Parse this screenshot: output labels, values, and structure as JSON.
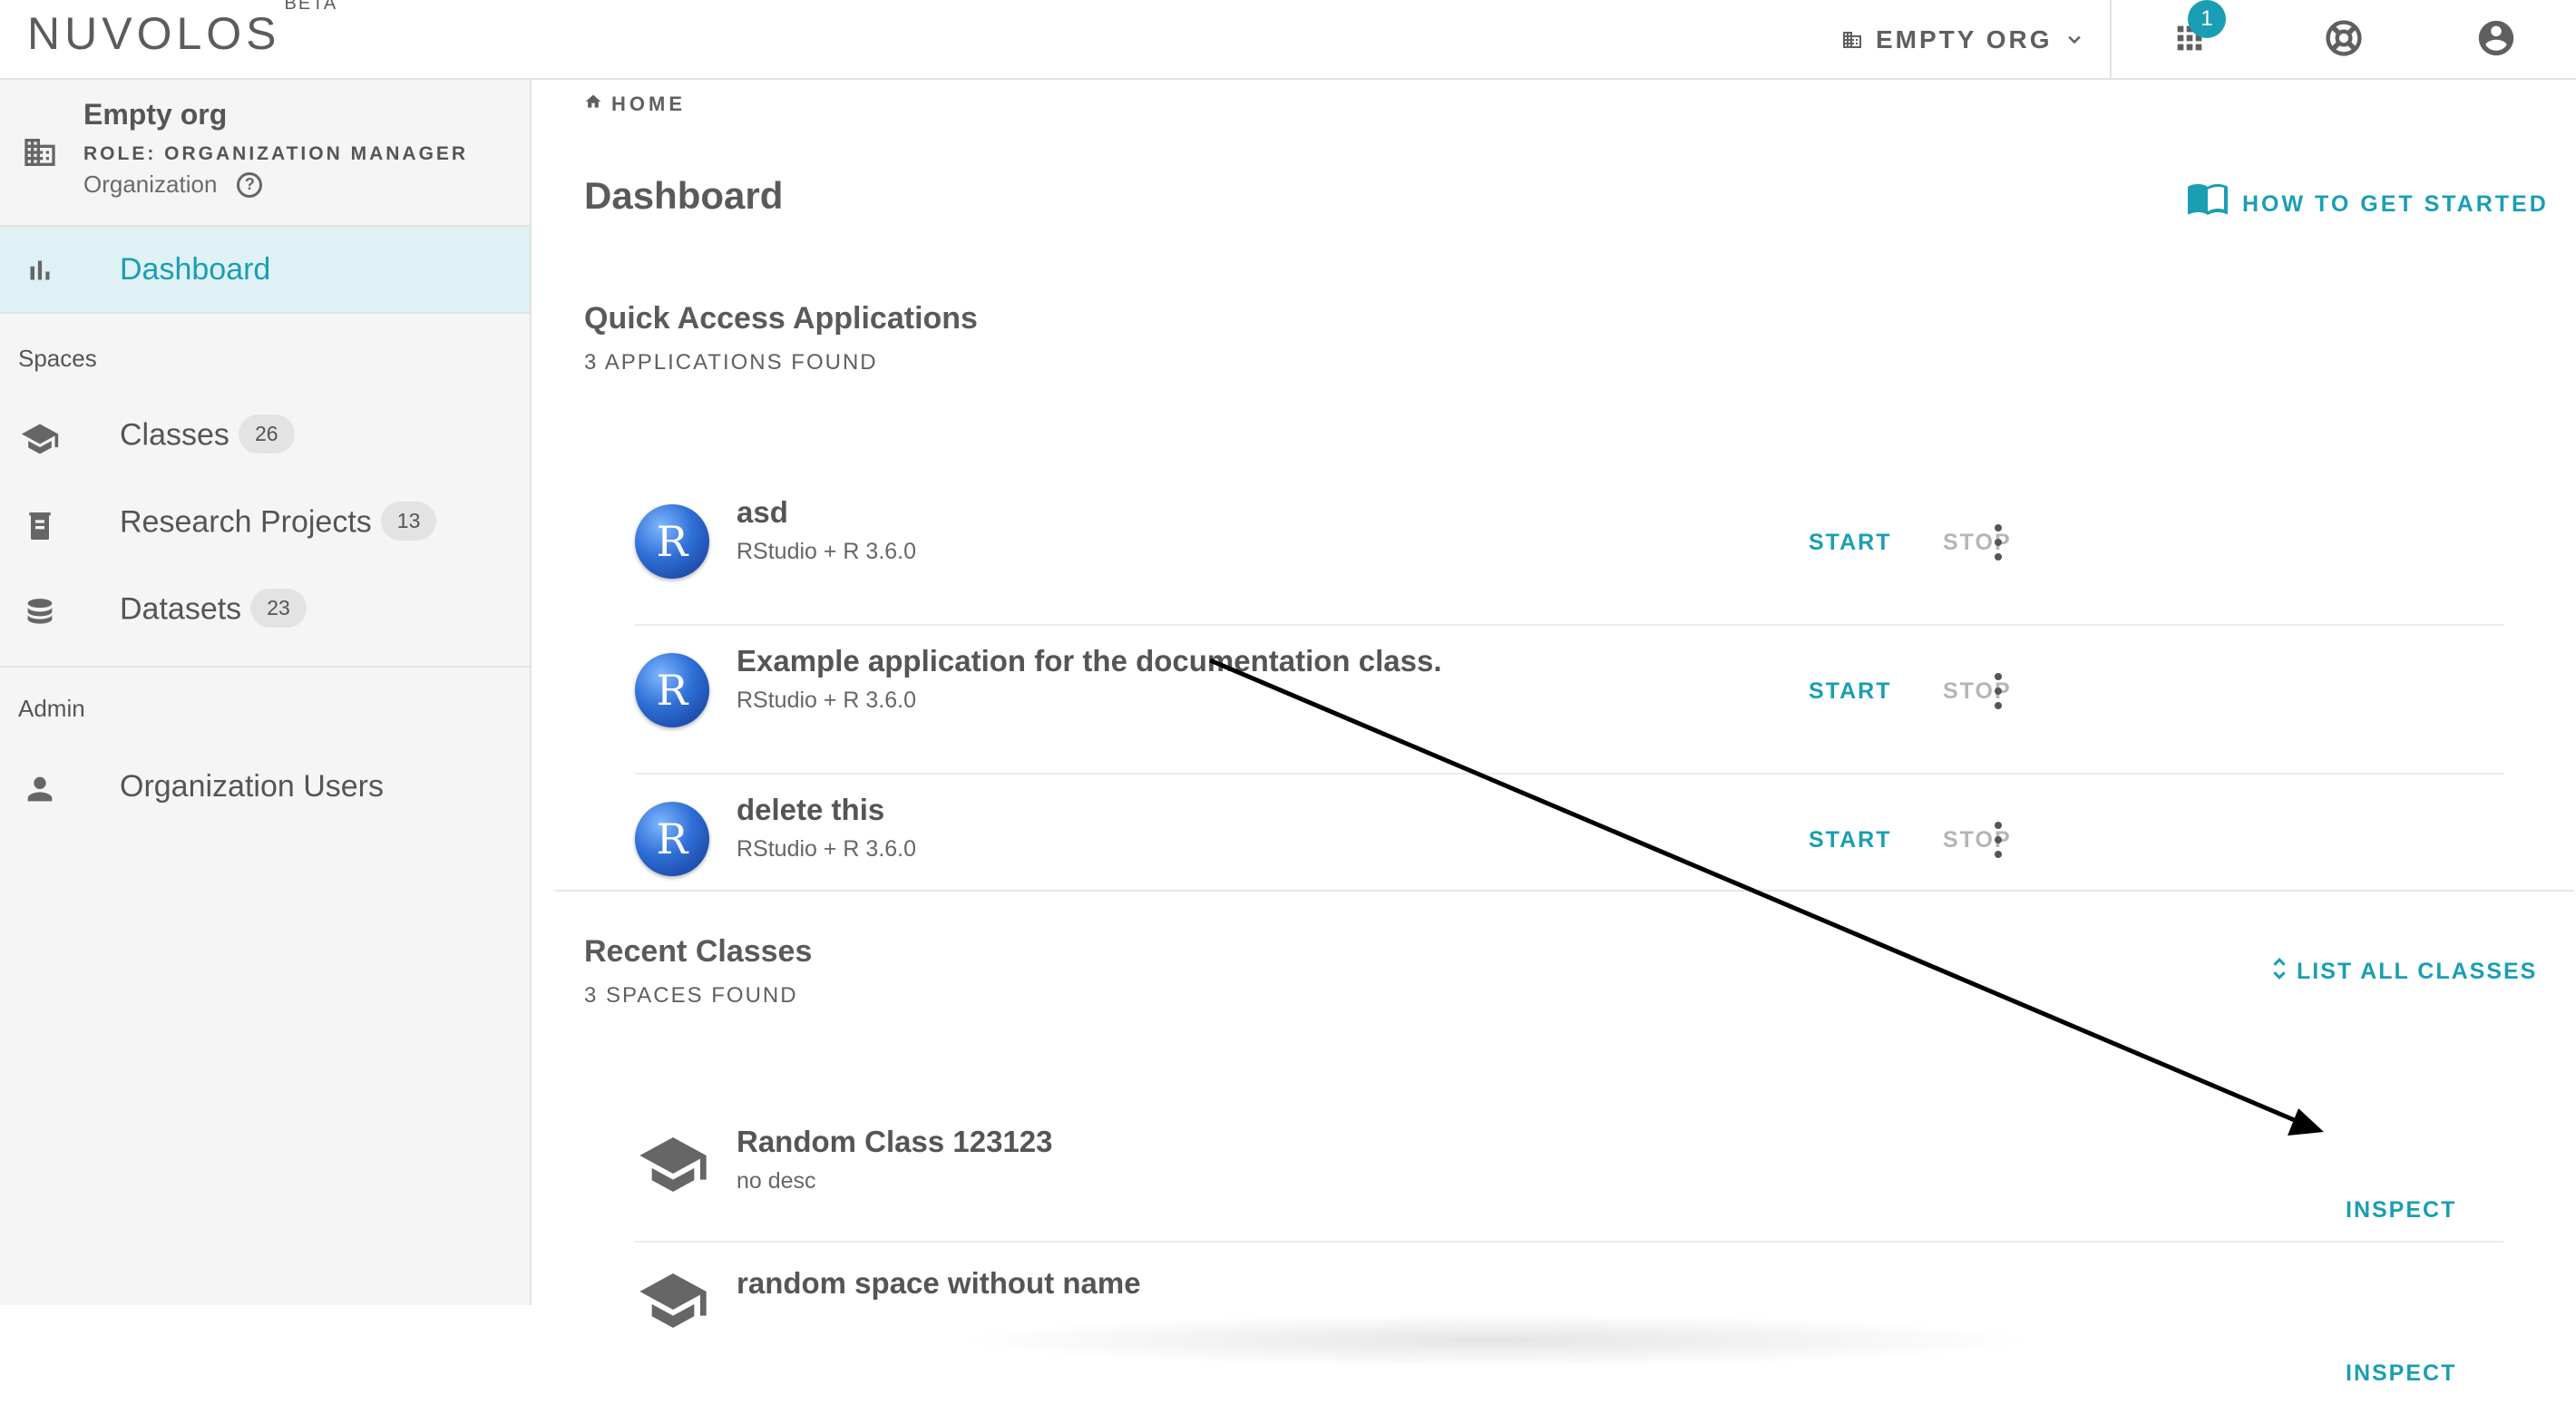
{
  "header": {
    "logo": "NUVOLOS",
    "logo_tag": "BETA",
    "org_selector": "EMPTY ORG",
    "notifications_count": "1"
  },
  "sidebar": {
    "org_name": "Empty org",
    "role": "ROLE: ORGANIZATION MANAGER",
    "org_type": "Organization",
    "dashboard_label": "Dashboard",
    "spaces_heading": "Spaces",
    "items": [
      {
        "label": "Classes",
        "count": "26"
      },
      {
        "label": "Research Projects",
        "count": "13"
      },
      {
        "label": "Datasets",
        "count": "23"
      }
    ],
    "admin_heading": "Admin",
    "admin_items": [
      {
        "label": "Organization Users"
      }
    ]
  },
  "main": {
    "breadcrumb": "HOME",
    "title": "Dashboard",
    "how_to": "HOW TO GET STARTED",
    "quick_access": {
      "title": "Quick Access Applications",
      "subtitle": "3 APPLICATIONS FOUND",
      "start_label": "START",
      "stop_label": "STOP",
      "apps": [
        {
          "name": "asd",
          "env": "RStudio + R 3.6.0",
          "logo": "R"
        },
        {
          "name": "Example application for the documentation class.",
          "env": "RStudio + R 3.6.0",
          "logo": "R"
        },
        {
          "name": "delete this",
          "env": "RStudio + R 3.6.0",
          "logo": "R"
        }
      ]
    },
    "recent_classes": {
      "title": "Recent Classes",
      "subtitle": "3 SPACES FOUND",
      "list_all": "LIST ALL CLASSES",
      "inspect_label": "INSPECT",
      "classes": [
        {
          "name": "Random Class 123123",
          "desc": "no desc"
        },
        {
          "name": "random space without name",
          "desc": ""
        }
      ]
    }
  },
  "colors": {
    "accent": "#1a9eb4",
    "active_nav_bg": "#dff1f4",
    "sidebar_bg": "#f5f5f5"
  }
}
